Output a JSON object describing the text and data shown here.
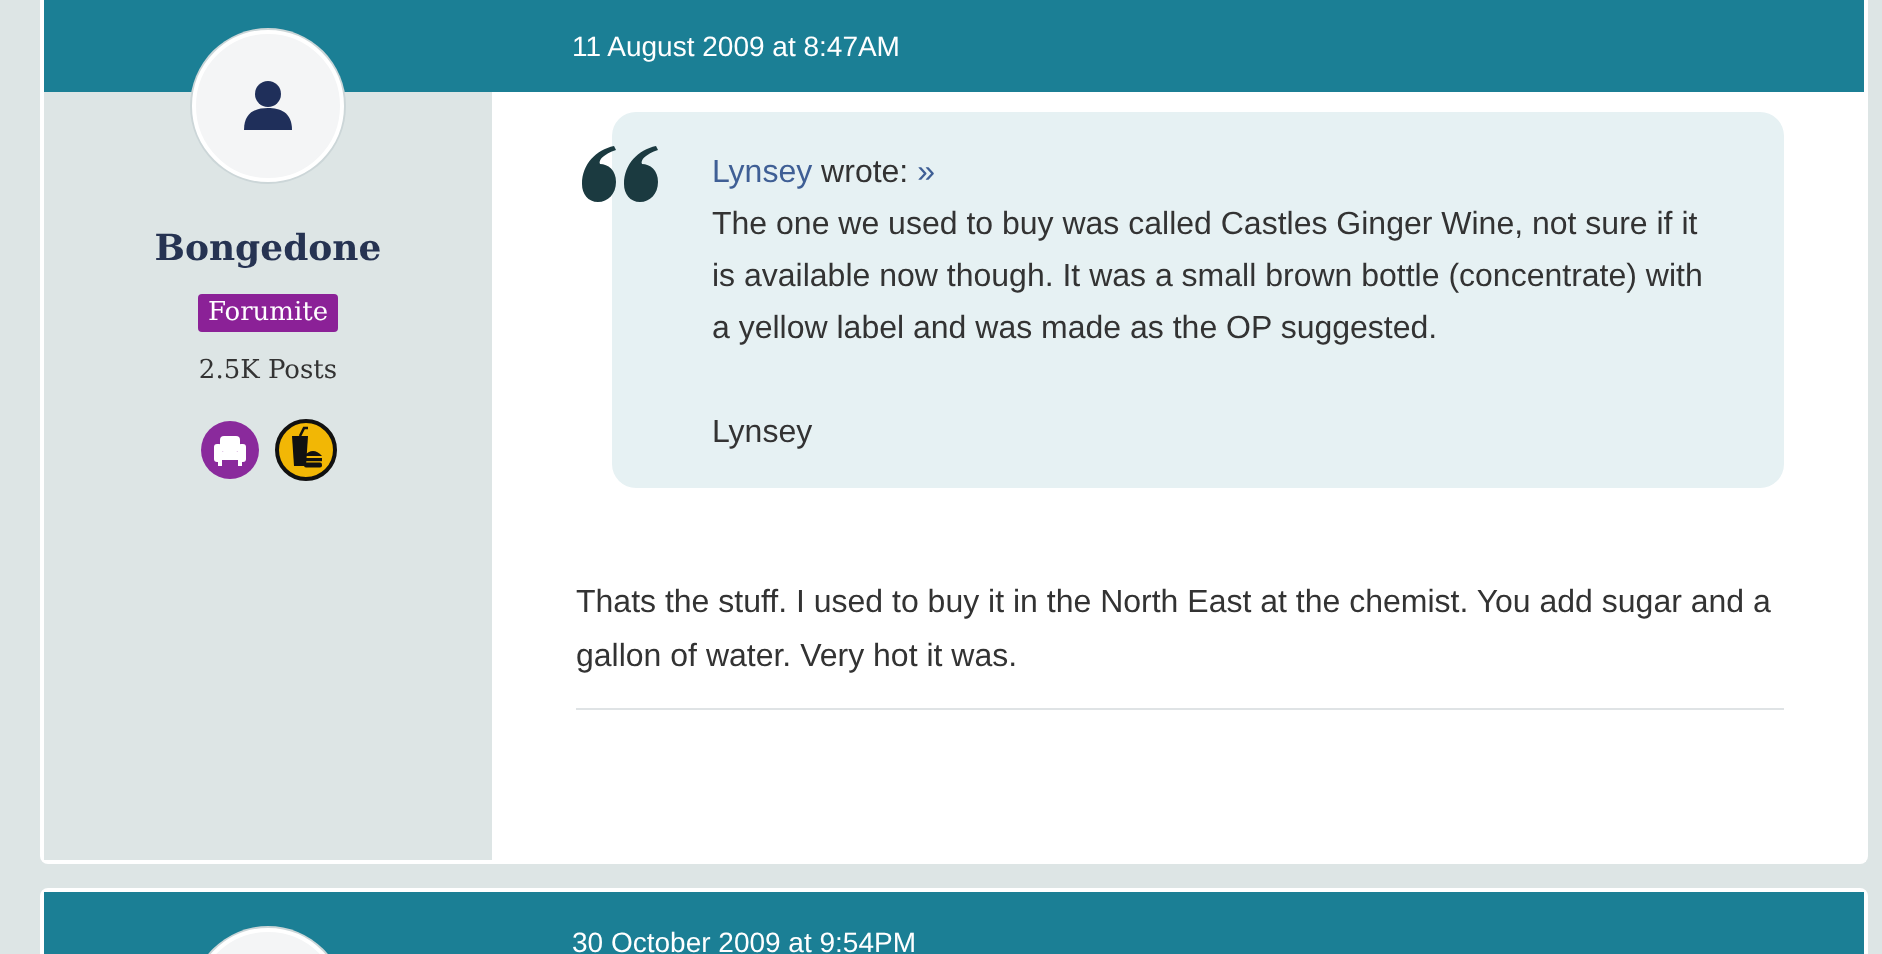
{
  "posts": [
    {
      "date": "11 August 2009 at 8:47AM",
      "author": {
        "name": "Bongedone",
        "rank": "Forumite",
        "posts": "2.5K Posts",
        "badges": [
          {
            "kind": "armchair"
          },
          {
            "kind": "fastfood"
          }
        ]
      },
      "quote": {
        "author": "Lynsey",
        "wrote": "wrote:",
        "jump": "»",
        "text": "The one we used to buy was called Castles Ginger Wine, not sure if it is available now though. It was a small brown bottle (concentrate) with a yellow label and was made as the OP suggested.",
        "signature": "Lynsey"
      },
      "body": "Thats the stuff. I used to buy it in the North East at the chemist. You add sugar and a gallon of water. Very hot it was."
    },
    {
      "date": "30 October 2009 at 9:54PM"
    }
  ]
}
